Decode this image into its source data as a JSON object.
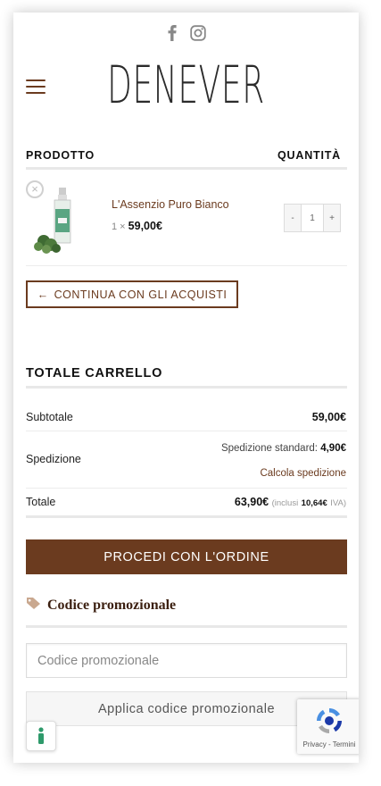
{
  "header": {
    "social": [
      {
        "name": "facebook-icon"
      },
      {
        "name": "instagram-icon"
      }
    ],
    "logo_text": "DENEVER"
  },
  "cart_table": {
    "col_product": "PRODOTTO",
    "col_quantity": "QUANTITÀ",
    "items": [
      {
        "name": "L'Assenzio Puro Bianco",
        "qty_prefix": "1 ×",
        "price": "59,00€",
        "quantity": "1"
      }
    ],
    "stepper_minus": "-",
    "stepper_plus": "+",
    "remove_glyph": "×"
  },
  "continue_button": {
    "arrow": "←",
    "label": "CONTINUA CON GLI ACQUISTI"
  },
  "totals": {
    "title": "TOTALE CARRELLO",
    "subtotal_label": "Subtotale",
    "subtotal_value": "59,00€",
    "shipping_label": "Spedizione",
    "shipping_method": "Spedizione standard:",
    "shipping_value": "4,90€",
    "shipping_calc_link": "Calcola spedizione",
    "total_label": "Totale",
    "total_value": "63,90€",
    "tax_prefix": "(inclusi",
    "tax_value": "10,64€",
    "tax_suffix": "IVA)"
  },
  "checkout_button": "PROCEDI CON L'ORDINE",
  "coupon": {
    "title": "Codice promozionale",
    "placeholder": "Codice promozionale",
    "apply_label": "Applica codice promozionale"
  },
  "recaptcha": {
    "terms": "Privacy - Termini"
  },
  "colors": {
    "accent": "#6b3b1f",
    "accessibility": "#2e9a6b"
  }
}
